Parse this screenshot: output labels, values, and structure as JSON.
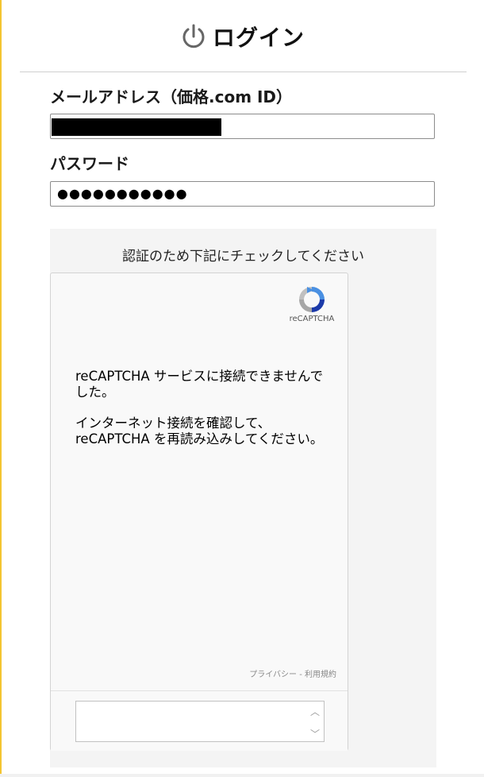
{
  "header": {
    "title": "ログイン",
    "icon": "power-icon"
  },
  "form": {
    "email_label": "メールアドレス（価格.com ID）",
    "password_label": "パスワード",
    "password_value": "●●●●●●●●●●●"
  },
  "captcha": {
    "note": "認証のため下記にチェックしてください",
    "brand": "reCAPTCHA",
    "error_line1": "reCAPTCHA サービスに接続できませんでした。",
    "error_line2": "インターネット接続を確認して、reCAPTCHA を再読み込みしてください。",
    "links": "プライバシー - 利用規約"
  },
  "colors": {
    "accent_frame": "#f4c531",
    "panel_bg": "#f4f4f4",
    "recaptcha_blue": "#4a90e2"
  }
}
